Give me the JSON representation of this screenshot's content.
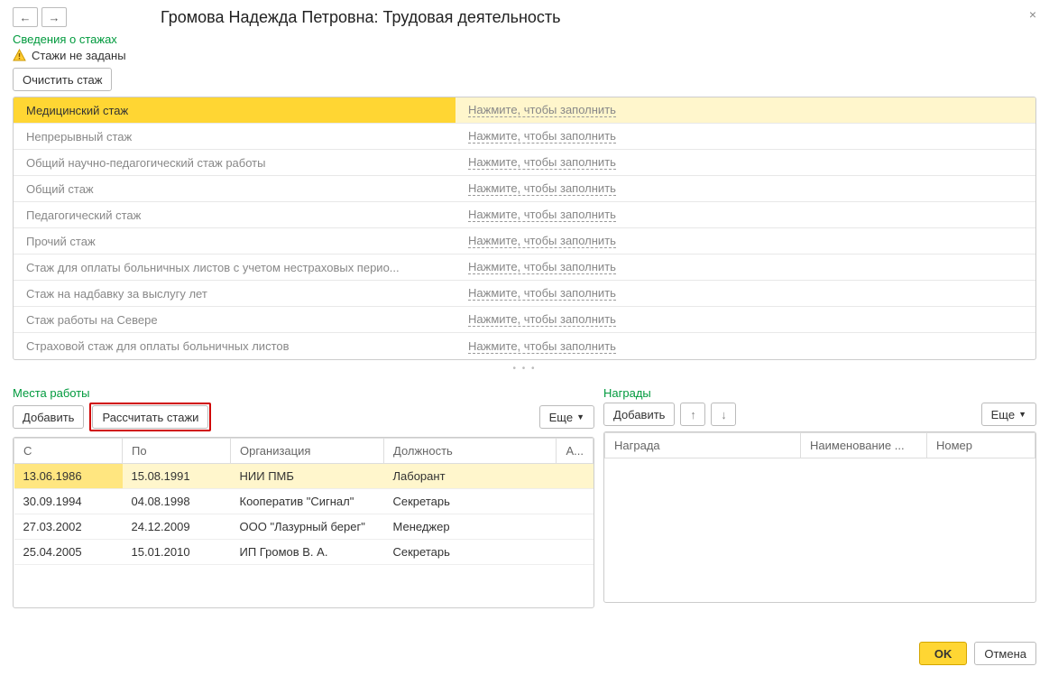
{
  "title": "Громова Надежда Петровна: Трудовая деятельность",
  "nav": {
    "back": "←",
    "forward": "→"
  },
  "close": "×",
  "sections": {
    "staj_label": "Сведения о стажах",
    "staj_warning": "Стажи не заданы",
    "clear_btn": "Очистить стаж",
    "fill_link": "Нажмите, чтобы заполнить",
    "types": [
      "Медицинский стаж",
      "Непрерывный стаж",
      "Общий научно-педагогический стаж работы",
      "Общий стаж",
      "Педагогический стаж",
      "Прочий стаж",
      "Стаж для оплаты больничных листов с учетом нестраховых перио...",
      "Стаж на надбавку за выслугу лет",
      "Стаж работы на Севере",
      "Страховой стаж для оплаты больничных листов"
    ]
  },
  "workplaces": {
    "label": "Места работы",
    "add_btn": "Добавить",
    "calc_btn": "Рассчитать стажи",
    "more_btn": "Еще",
    "columns": {
      "from": "С",
      "to": "По",
      "org": "Организация",
      "pos": "Должность",
      "last": "А..."
    },
    "rows": [
      {
        "from": "13.06.1986",
        "to": "15.08.1991",
        "org": "НИИ ПМБ",
        "pos": "Лаборант"
      },
      {
        "from": "30.09.1994",
        "to": "04.08.1998",
        "org": "Кооператив \"Сигнал\"",
        "pos": "Секретарь"
      },
      {
        "from": "27.03.2002",
        "to": "24.12.2009",
        "org": "ООО \"Лазурный берег\"",
        "pos": "Менеджер"
      },
      {
        "from": "25.04.2005",
        "to": "15.01.2010",
        "org": "ИП Громов В. А.",
        "pos": "Секретарь"
      }
    ]
  },
  "awards": {
    "label": "Награды",
    "add_btn": "Добавить",
    "more_btn": "Еще",
    "columns": {
      "award": "Награда",
      "name": "Наименование ...",
      "num": "Номер"
    }
  },
  "footer": {
    "ok": "OK",
    "cancel": "Отмена"
  }
}
